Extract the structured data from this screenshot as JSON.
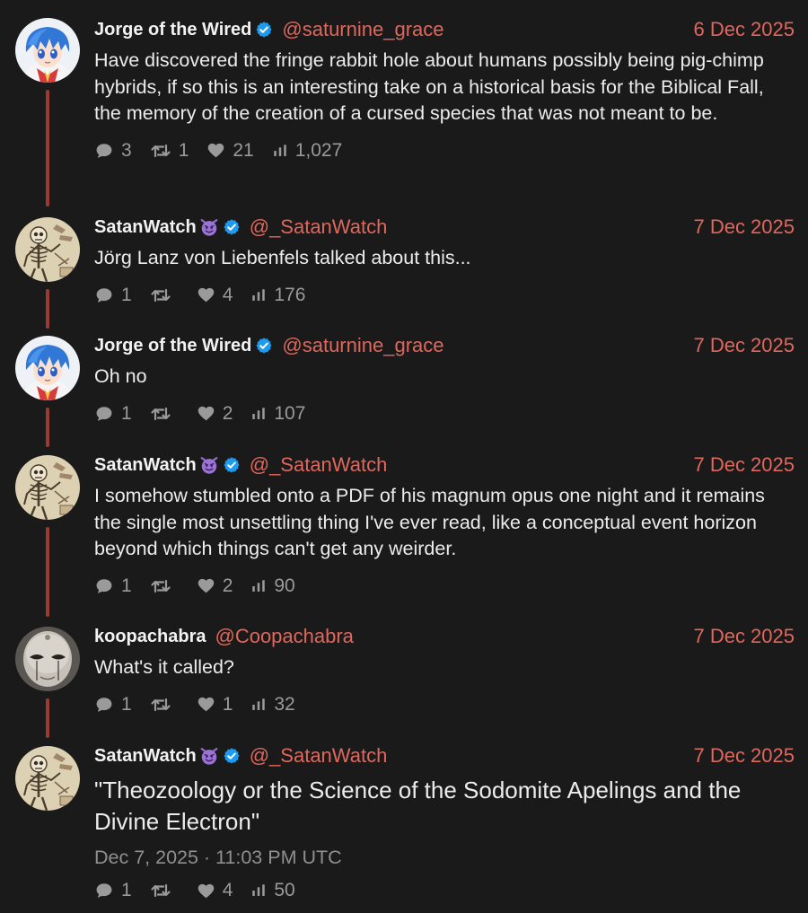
{
  "tweets": [
    {
      "name": "Jorge of the Wired",
      "handle": "@saturnine_grace",
      "date": "6 Dec 2025",
      "text": "Have discovered the fringe rabbit hole about humans possibly being pig-chimp hybrids, if so this is an interesting take on a historical basis for the Biblical Fall, the memory of the creation of a cursed species that was not meant to be.",
      "replies": "3",
      "retweets": "1",
      "likes": "21",
      "views": "1,027"
    },
    {
      "name": "SatanWatch",
      "name_emoji": "smiling-imp-emoji",
      "handle": "@_SatanWatch",
      "date": "7 Dec 2025",
      "text": "Jörg Lanz von Liebenfels talked about this...",
      "replies": "1",
      "retweets": "",
      "likes": "4",
      "views": "176"
    },
    {
      "name": "Jorge of the Wired",
      "handle": "@saturnine_grace",
      "date": "7 Dec 2025",
      "text": "Oh no",
      "replies": "1",
      "retweets": "",
      "likes": "2",
      "views": "107"
    },
    {
      "name": "SatanWatch",
      "name_emoji": "smiling-imp-emoji",
      "handle": "@_SatanWatch",
      "date": "7 Dec 2025",
      "text": "I somehow stumbled onto a PDF of his magnum opus one night and it remains the single most unsettling thing I've ever read, like a conceptual event horizon beyond which things can't get any weirder.",
      "replies": "1",
      "retweets": "",
      "likes": "2",
      "views": "90"
    },
    {
      "name": "koopachabra",
      "handle": "@Coopachabra",
      "date": "7 Dec 2025",
      "text": "What's it called?",
      "replies": "1",
      "retweets": "",
      "likes": "1",
      "views": "32"
    },
    {
      "name": "SatanWatch",
      "name_emoji": "smiling-imp-emoji",
      "handle": "@_SatanWatch",
      "date": "7 Dec 2025",
      "text": "\"Theozoology or the Science of the Sodomite Apelings and the Divine Electron\"",
      "timestamp": "Dec 7, 2025 · 11:03 PM UTC",
      "replies": "1",
      "retweets": "",
      "likes": "4",
      "views": "50"
    }
  ],
  "colors": {
    "background": "#1a1a1b",
    "accent": "#e0675c",
    "thread_line": "#9b3a30",
    "verified": "#1d9bf0",
    "muted": "#9a9a9a"
  },
  "icons": {
    "reply": "speech-bubble-icon",
    "retweet": "retweet-icon",
    "like": "heart-icon",
    "views": "bar-chart-icon",
    "verified": "verified-badge-icon"
  }
}
